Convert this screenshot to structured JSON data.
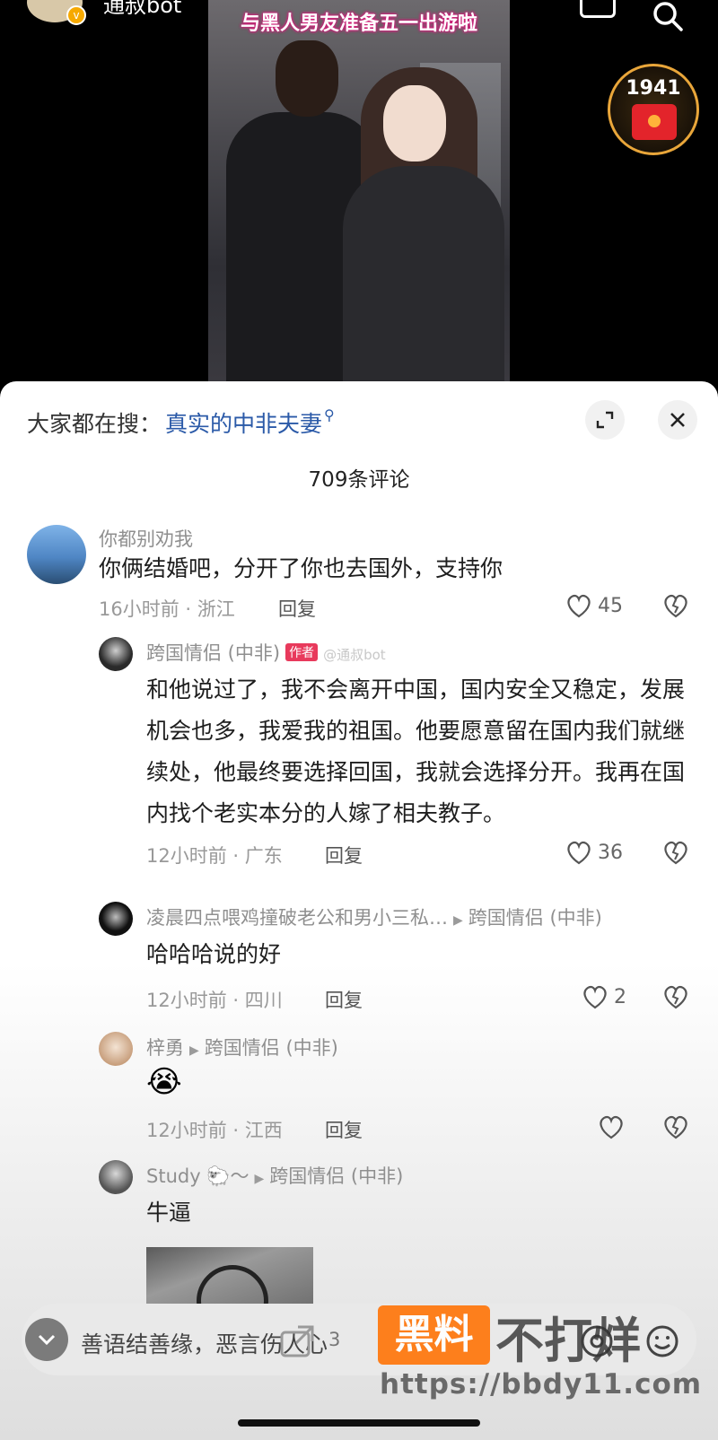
{
  "video": {
    "author_name": "通叔bot",
    "caption": "与黑人男友准备五一出游啦",
    "gift_count": "1941"
  },
  "panel": {
    "search_hint_label": "大家都在搜：",
    "search_hint_term": "真实的中非夫妻",
    "comment_count": "709条评论"
  },
  "comments": [
    {
      "username": "你都别劝我",
      "text": "你俩结婚吧，分开了你也去国外，支持你",
      "meta": "16小时前 · 浙江",
      "reply": "回复",
      "likes": "45"
    },
    {
      "username": "跨国情侣 (中非)",
      "author_tag": "作者",
      "watermark": "@通叔bot",
      "text": "和他说过了，我不会离开中国，国内安全又稳定，发展机会也多，我爱我的祖国。他要愿意留在国内我们就继续处，他最终要选择回国，我就会选择分开。我再在国内找个老实本分的人嫁了相夫教子。",
      "meta": "12小时前 · 广东",
      "reply": "回复",
      "likes": "36"
    },
    {
      "username": "凌晨四点喂鸡撞破老公和男小三私…",
      "reply_to": "跨国情侣 (中非)",
      "text": "哈哈哈说的好",
      "meta": "12小时前 · 四川",
      "reply": "回复",
      "likes": "2"
    },
    {
      "username": "梓勇",
      "reply_to": "跨国情侣 (中非)",
      "emoji": "😭",
      "meta": "12小时前 · 江西",
      "reply": "回复",
      "likes": ""
    },
    {
      "username": "Study 🐑～",
      "reply_to": "跨国情侣 (中非)",
      "text": "牛逼"
    }
  ],
  "bottom": {
    "placeholder": "善语结善缘，恶言伤人心",
    "share_count": "3"
  },
  "overlay_watermark": {
    "badge": "黑料",
    "text": "不打烊",
    "url": "https://bbdy11.com"
  }
}
